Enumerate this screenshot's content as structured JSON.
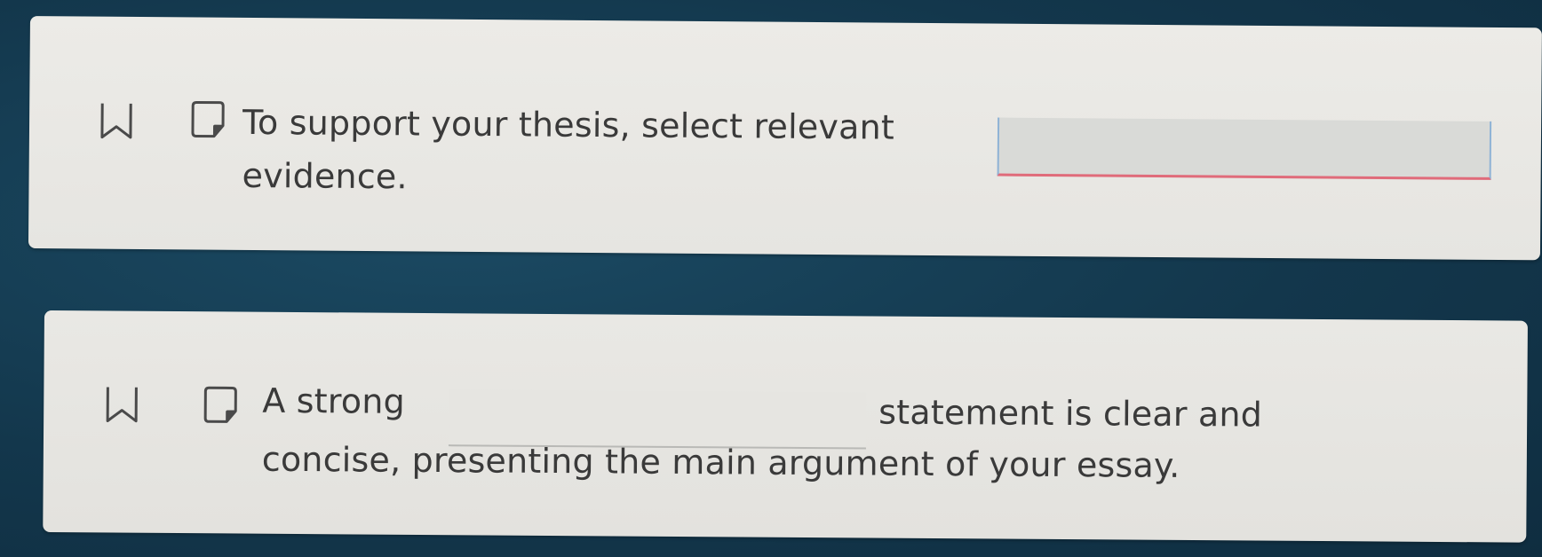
{
  "questions": [
    {
      "text_before": "To support your thesis, select relevant",
      "text_after": "evidence.",
      "blank_value": ""
    },
    {
      "text_before": "A strong",
      "text_middle": "statement is clear and",
      "text_after": "concise, presenting the main argument of your essay.",
      "blank_value": ""
    }
  ],
  "icons": {
    "bookmark": "bookmark-icon",
    "note": "note-icon"
  },
  "colors": {
    "background": "#14384d",
    "card": "#e9e9e6",
    "text": "#3a3a3a",
    "blank_underline_active": "#e06b7a",
    "blank_border_active": "#8fb3d6"
  }
}
